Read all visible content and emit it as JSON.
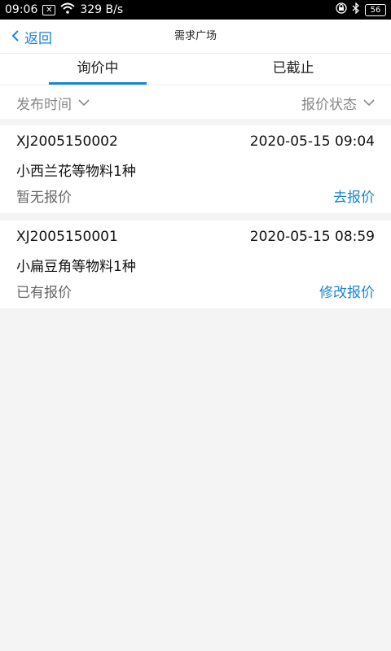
{
  "status_bar": {
    "time": "09:06",
    "notification_icon": "x-box-icon",
    "speed": "329 B/s",
    "battery": "56"
  },
  "nav": {
    "back_label": "返回",
    "title": "需求广场"
  },
  "tabs": [
    {
      "label": "询价中",
      "active": true
    },
    {
      "label": "已截止",
      "active": false
    }
  ],
  "filters": {
    "time_label": "发布时间",
    "status_label": "报价状态"
  },
  "items": [
    {
      "id": "XJ2005150002",
      "datetime": "2020-05-15 09:04",
      "title": "小西兰花等物料1种",
      "status": "暂无报价",
      "action": "去报价"
    },
    {
      "id": "XJ2005150001",
      "datetime": "2020-05-15 08:59",
      "title": "小扁豆角等物料1种",
      "status": "已有报价",
      "action": "修改报价"
    }
  ],
  "colors": {
    "accent": "#1a85d6",
    "background": "#f4f4f4"
  }
}
